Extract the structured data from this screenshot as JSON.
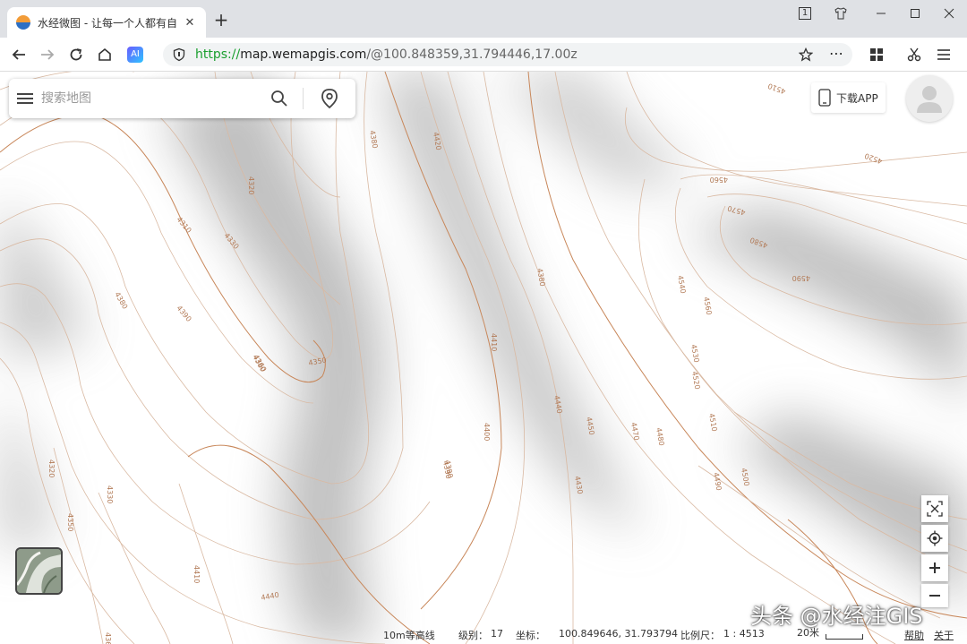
{
  "browser": {
    "tab_title": "水经微图 - 让每一个人都有自",
    "tab_close": "✕",
    "new_tab": "+",
    "url": {
      "scheme": "https://",
      "host": "map.wemapgis.com",
      "path": "/@100.848359,31.794446,17.00z"
    },
    "ai_badge": "AI",
    "window_counter": "1"
  },
  "search": {
    "placeholder": "搜索地图"
  },
  "download_app": {
    "label": "下载APP"
  },
  "contours": {
    "labels": [
      "4510",
      "4520",
      "4560",
      "4570",
      "4580",
      "4590",
      "4540",
      "4560",
      "4530",
      "4520",
      "4510",
      "4500",
      "4490",
      "4480",
      "4470",
      "4450",
      "4440",
      "4430",
      "4410",
      "4400",
      "4390",
      "4420",
      "4380",
      "4320",
      "4310",
      "4330",
      "4380",
      "4390",
      "4380",
      "4350",
      "4320",
      "4330",
      "4350",
      "4360",
      "4410",
      "4440",
      "4390",
      "4360",
      "4380"
    ]
  },
  "status": {
    "contour_interval": "10m等高线",
    "level_label": "级别：",
    "level_value": "17",
    "coord_label": "坐标：",
    "coord_value": "100.849646, 31.793794",
    "scale_label": "比例尺：",
    "scale_value": "1 : 4513",
    "scalebar_label": "20米",
    "help": "帮助",
    "about": "关于"
  },
  "watermark": "头条 @水经注GIS",
  "colors": {
    "contour_major": "#c8875a",
    "contour_minor": "#d9b9a2",
    "https_green": "#1a9f2f"
  },
  "icons": [
    "menu-icon",
    "search-icon",
    "location-pin-icon",
    "phone-icon",
    "avatar-icon",
    "screenshot-icon",
    "locate-icon",
    "zoom-in-icon",
    "zoom-out-icon"
  ]
}
